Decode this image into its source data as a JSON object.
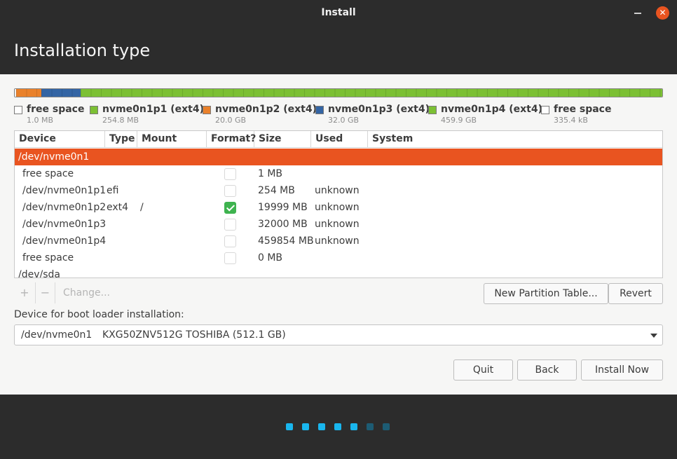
{
  "window": {
    "title": "Install",
    "minimize_glyph": "",
    "close_glyph": "✕"
  },
  "page": {
    "title": "Installation type"
  },
  "colors": {
    "accent": "#e95420",
    "green": "#7cc034",
    "blue": "#3465a4",
    "orange": "#e9812b",
    "free": "#ffffff"
  },
  "legend": [
    {
      "name": "free space",
      "size": "1.0 MB",
      "color": "#ffffff"
    },
    {
      "name": "nvme0n1p1 (ext4)",
      "size": "254.8 MB",
      "color": "#7cc034"
    },
    {
      "name": "nvme0n1p2 (ext4)",
      "size": "20.0 GB",
      "color": "#e9812b"
    },
    {
      "name": "nvme0n1p3 (ext4)",
      "size": "32.0 GB",
      "color": "#3465a4"
    },
    {
      "name": "nvme0n1p4 (ext4)",
      "size": "459.9 GB",
      "color": "#7cc034"
    },
    {
      "name": "free space",
      "size": "335.4 kB",
      "color": "#ffffff"
    }
  ],
  "table": {
    "headers": {
      "device": "Device",
      "type": "Type",
      "mount": "Mount point",
      "format": "Format?",
      "size": "Size",
      "used": "Used",
      "system": "System"
    },
    "rows": [
      {
        "device": "/dev/nvme0n1",
        "type": "",
        "mount": "",
        "format": null,
        "size": "",
        "used": "",
        "selected": true,
        "indent": false
      },
      {
        "device": "free space",
        "type": "",
        "mount": "",
        "format": false,
        "size": "1 MB",
        "used": "",
        "selected": false,
        "indent": true
      },
      {
        "device": "/dev/nvme0n1p1",
        "type": "efi",
        "mount": "",
        "format": false,
        "size": "254 MB",
        "used": "unknown",
        "selected": false,
        "indent": true
      },
      {
        "device": "/dev/nvme0n1p2",
        "type": "ext4",
        "mount": "/",
        "format": true,
        "size": "19999 MB",
        "used": "unknown",
        "selected": false,
        "indent": true
      },
      {
        "device": "/dev/nvme0n1p3",
        "type": "",
        "mount": "",
        "format": false,
        "size": "32000 MB",
        "used": "unknown",
        "selected": false,
        "indent": true
      },
      {
        "device": "/dev/nvme0n1p4",
        "type": "",
        "mount": "",
        "format": false,
        "size": "459854 MB",
        "used": "unknown",
        "selected": false,
        "indent": true
      },
      {
        "device": "free space",
        "type": "",
        "mount": "",
        "format": false,
        "size": "0 MB",
        "used": "",
        "selected": false,
        "indent": true
      },
      {
        "device": "/dev/sda",
        "type": "",
        "mount": "",
        "format": null,
        "size": "",
        "used": "",
        "selected": false,
        "indent": false
      }
    ]
  },
  "toolbar": {
    "add": "+",
    "remove": "−",
    "change": "Change...",
    "new_table": "New Partition Table...",
    "revert": "Revert"
  },
  "bootloader": {
    "label": "Device for boot loader installation:",
    "device": "/dev/nvme0n1",
    "model": "KXG50ZNV512G TOSHIBA (512.1 GB)"
  },
  "buttons": {
    "quit": "Quit",
    "back": "Back",
    "install": "Install Now"
  },
  "progress": {
    "total_steps": 7,
    "completed_steps": 5,
    "dot_active_color": "#19b6ee",
    "dot_inactive_color": "#1d5c74"
  }
}
